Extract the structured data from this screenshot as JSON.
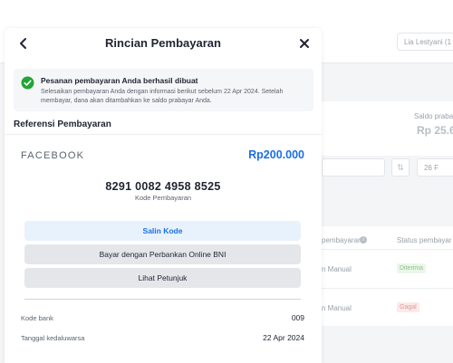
{
  "background": {
    "user_button": "Lia Lestyani (1",
    "saldo_label": "Saldo prabay",
    "saldo_value": "Rp 25.6",
    "filter_icon": "sliders-icon",
    "date_value": "26 F",
    "table_header_metode": "pembayaran",
    "table_header_status": "Status pembayar",
    "row1_metode": "n Manual",
    "row1_status": "Diterima",
    "row2_metode": "n Manual",
    "row2_status": "Gagal"
  },
  "modal": {
    "title": "Rincian Pembayaran",
    "back_icon": "chevron-left-icon",
    "close_icon": "close-icon",
    "alert": {
      "icon": "check-circle-icon",
      "title": "Pesanan pembayaran Anda berhasil dibuat",
      "text": "Selesaikan pembayaran Anda dengan informasi berikut sebelum 22 Apr 2024. Setelah membayar, dana akan ditambahkan ke saldo prabayar Anda."
    },
    "section_title": "Referensi Pembayaran",
    "merchant": "FACEBOOK",
    "amount": "Rp200.000",
    "payment_code": "8291 0082 4958 8525",
    "payment_code_label": "Kode Pembayaran",
    "buttons": {
      "copy": "Salin Kode",
      "pay": "Bayar dengan Perbankan Online BNI",
      "guide": "Lihat Petunjuk"
    },
    "details": [
      {
        "label": "Kode bank",
        "value": "009"
      },
      {
        "label": "Tanggal kedaluwarsa",
        "value": "22 Apr 2024"
      }
    ]
  },
  "colors": {
    "accent": "#1a6fe8",
    "success": "#23a536",
    "button_copy_bg": "#e8f2fc",
    "button_secondary_bg": "#e4e6ea"
  }
}
